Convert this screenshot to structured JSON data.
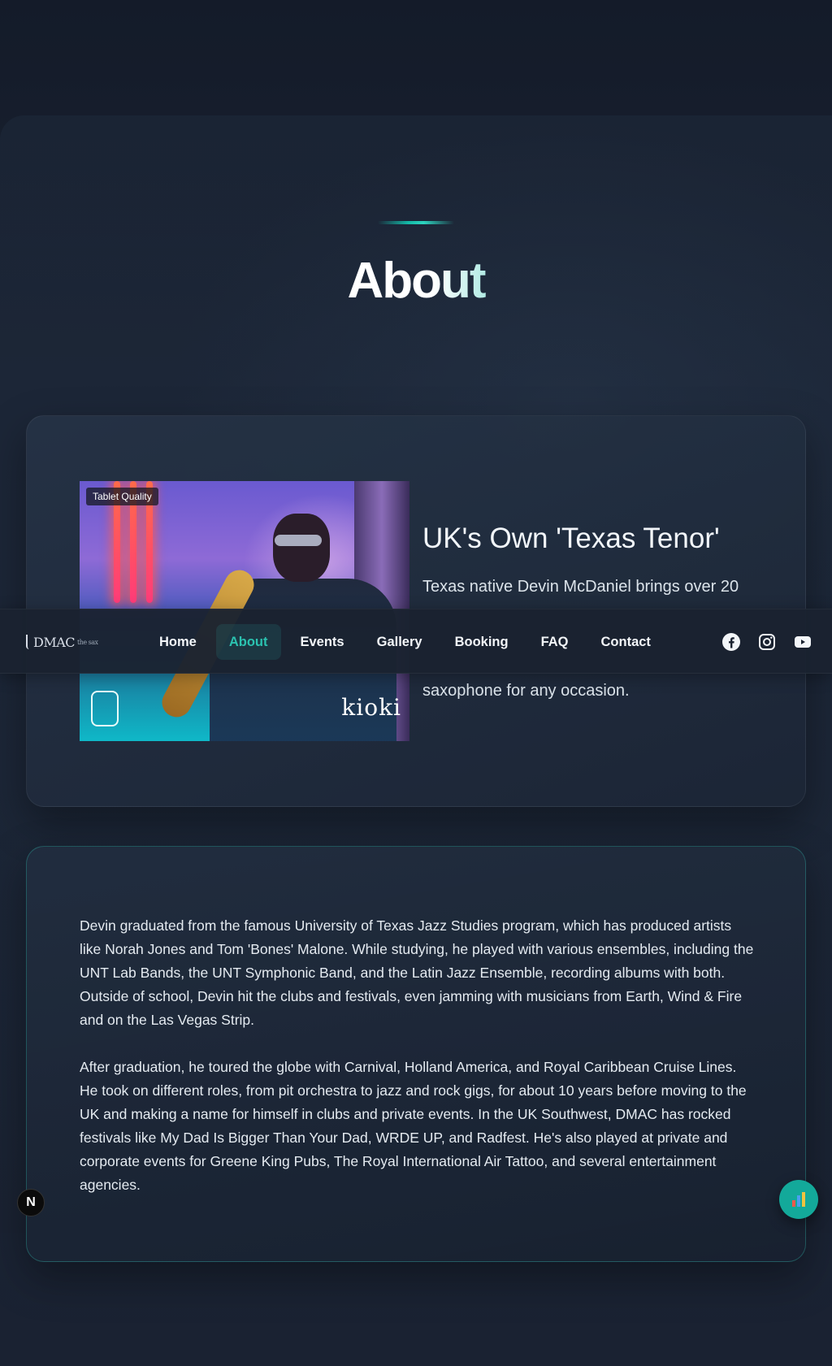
{
  "hero": {
    "title": "About"
  },
  "intro_card": {
    "photo_badge": "Tablet Quality",
    "photo_brand": "kioki",
    "heading": "UK's Own 'Texas Tenor'",
    "paragraph_visible_top": "Texas native Devin McDaniel brings over 20",
    "paragraph_visible_bottom": "saxophone for any occasion."
  },
  "bio_card": {
    "paragraphs": [
      "Devin graduated from the famous University of Texas Jazz Studies program, which has produced artists like Norah Jones and Tom 'Bones' Malone. While studying, he played with various ensembles, including the UNT Lab Bands, the UNT Symphonic Band, and the Latin Jazz Ensemble, recording albums with both. Outside of school, Devin hit the clubs and festivals, even jamming with musicians from Earth, Wind & Fire and on the Las Vegas Strip.",
      "After graduation, he toured the globe with Carnival, Holland America, and Royal Caribbean Cruise Lines. He took on different roles, from pit orchestra to jazz and rock gigs, for about 10 years before moving to the UK and making a name for himself in clubs and private events. In the UK Southwest, DMAC has rocked festivals like My Dad Is Bigger Than Your Dad, WRDE UP, and Radfest. He's also played at private and corporate events for Greene King Pubs, The Royal International Air Tattoo, and several entertainment agencies."
    ]
  },
  "nav": {
    "logo_text": "DMAC",
    "logo_sub": "the sax",
    "links": [
      {
        "label": "Home",
        "active": false
      },
      {
        "label": "About",
        "active": true
      },
      {
        "label": "Events",
        "active": false
      },
      {
        "label": "Gallery",
        "active": false
      },
      {
        "label": "Booking",
        "active": false
      },
      {
        "label": "FAQ",
        "active": false
      },
      {
        "label": "Contact",
        "active": false
      }
    ],
    "social_icons": [
      "facebook-icon",
      "instagram-icon",
      "youtube-icon"
    ]
  },
  "floating": {
    "left_button": "N",
    "right_button_icon": "bar-chart-icon"
  },
  "colors": {
    "accent": "#2bc2b0",
    "background": "#182131",
    "fab": "#13a99a"
  }
}
